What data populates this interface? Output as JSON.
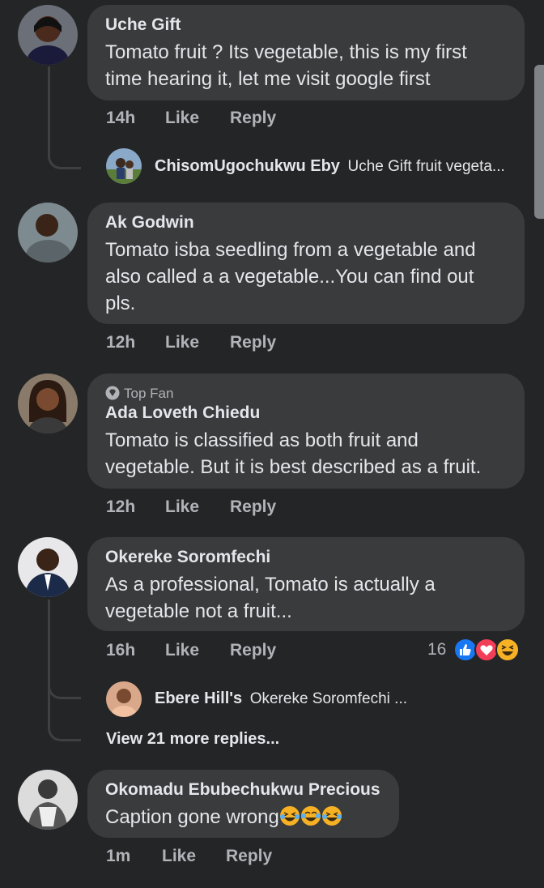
{
  "comments": [
    {
      "author": "Uche Gift",
      "text_lines": [
        "Tomato fruit ? Its vegetable, this is my first",
        "time hearing it, let me visit google first"
      ],
      "time": "14h",
      "like": "Like",
      "reply": "Reply",
      "reply_preview": {
        "author": "ChisomUgochukwu Eby",
        "text": "Uche Gift fruit vegeta..."
      }
    },
    {
      "author": "Ak Godwin",
      "text_lines": [
        "Tomato isba seedling from a vegetable and",
        "also called a a vegetable...You can find out",
        "pls."
      ],
      "time": "12h",
      "like": "Like",
      "reply": "Reply"
    },
    {
      "badge": "Top Fan",
      "author": "Ada Loveth Chiedu",
      "text_lines": [
        "Tomato is classified as both fruit and",
        "vegetable. But it is best described as a fruit."
      ],
      "time": "12h",
      "like": "Like",
      "reply": "Reply"
    },
    {
      "author": "Okereke Soromfechi",
      "text_lines": [
        "As a professional, Tomato is actually a",
        "vegetable not a fruit..."
      ],
      "time": "16h",
      "like": "Like",
      "reply": "Reply",
      "reaction_count": "16",
      "reply_preview": {
        "author": "Ebere Hill's",
        "text": "Okereke Soromfechi ..."
      },
      "view_more": "View 21 more replies..."
    },
    {
      "author": "Okomadu Ebubechukwu Precious",
      "text": "Caption gone wrong",
      "time": "1m",
      "like": "Like",
      "reply": "Reply"
    }
  ],
  "colors": {
    "background": "#242526",
    "bubble": "#3a3b3c",
    "meta": "#b0b3b8",
    "text": "#e4e6eb",
    "like_blue": "#1877f2",
    "love_red": "#f33e58",
    "haha_yellow": "#f7b125"
  },
  "icons": [
    "like-reaction-icon",
    "love-reaction-icon",
    "haha-reaction-icon",
    "top-fan-diamond-icon",
    "laughing-tears-emoji"
  ]
}
